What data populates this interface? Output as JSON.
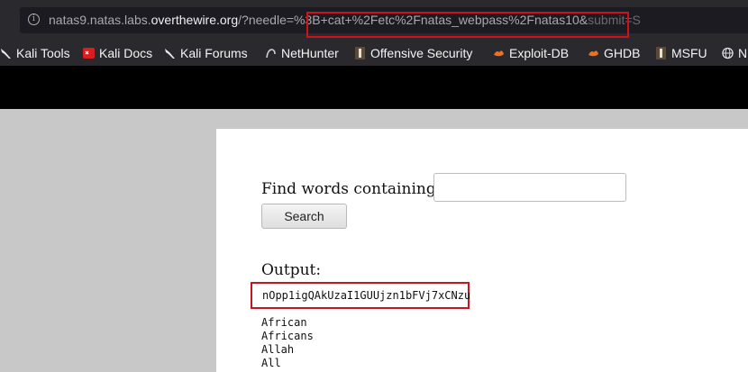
{
  "browser": {
    "url_host_prefix": "natas9.natas.labs.",
    "url_host_main": "overthewire.org",
    "url_path": "/?needle=",
    "url_query_highlight": "%3B+cat+%2Fetc%2Fnatas_webpass%2Fnatas10&",
    "url_tail": "submit=S"
  },
  "bookmarks": [
    {
      "label": "Kali Tools",
      "icon": "kali-dragon-icon"
    },
    {
      "label": "Kali Docs",
      "icon": "kali-docs-icon"
    },
    {
      "label": "Kali Forums",
      "icon": "kali-dragon-icon"
    },
    {
      "label": "NetHunter",
      "icon": "nethunter-icon"
    },
    {
      "label": "Offensive Security",
      "icon": "offsec-icon"
    },
    {
      "label": "Exploit-DB",
      "icon": "exploitdb-icon"
    },
    {
      "label": "GHDB",
      "icon": "ghdb-icon"
    },
    {
      "label": "MSFU",
      "icon": "msfu-icon"
    },
    {
      "label": "N",
      "icon": "globe-icon"
    }
  ],
  "form": {
    "label": "Find words containing:",
    "input_value": "",
    "button": "Search"
  },
  "output": {
    "label": "Output:",
    "password": "nOpp1igQAkUzaI1GUUjzn1bFVj7xCNzu",
    "words": [
      "African",
      "Africans",
      "Allah",
      "All"
    ]
  },
  "colors": {
    "highlight": "#d0101b"
  }
}
